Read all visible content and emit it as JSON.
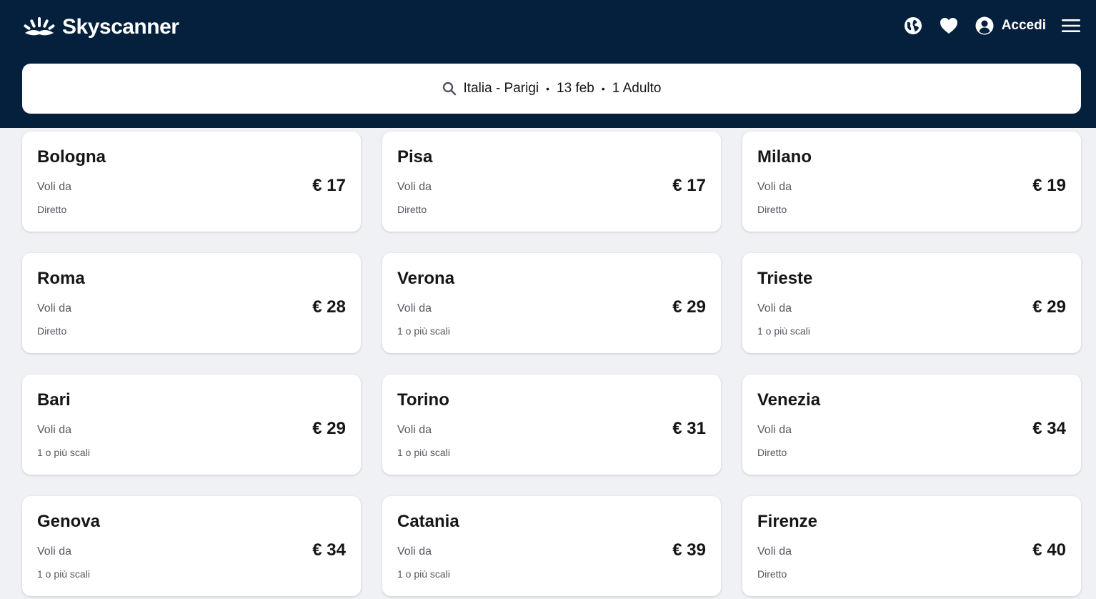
{
  "brand": {
    "name": "Skyscanner"
  },
  "nav": {
    "login_label": "Accedi"
  },
  "search": {
    "route": "Italia - Parigi",
    "date": "13 feb",
    "travellers": "1 Adulto",
    "separator": "•"
  },
  "colors": {
    "header_bg": "#05203c",
    "page_bg": "#eff1f5",
    "card_bg": "#ffffff"
  },
  "results": [
    {
      "city": "Bologna",
      "label": "Voli da",
      "price": "€ 17",
      "stops": "Diretto"
    },
    {
      "city": "Pisa",
      "label": "Voli da",
      "price": "€ 17",
      "stops": "Diretto"
    },
    {
      "city": "Milano",
      "label": "Voli da",
      "price": "€ 19",
      "stops": "Diretto"
    },
    {
      "city": "Roma",
      "label": "Voli da",
      "price": "€ 28",
      "stops": "Diretto"
    },
    {
      "city": "Verona",
      "label": "Voli da",
      "price": "€ 29",
      "stops": "1 o più scali"
    },
    {
      "city": "Trieste",
      "label": "Voli da",
      "price": "€ 29",
      "stops": "1 o più scali"
    },
    {
      "city": "Bari",
      "label": "Voli da",
      "price": "€ 29",
      "stops": "1 o più scali"
    },
    {
      "city": "Torino",
      "label": "Voli da",
      "price": "€ 31",
      "stops": "1 o più scali"
    },
    {
      "city": "Venezia",
      "label": "Voli da",
      "price": "€ 34",
      "stops": "Diretto"
    },
    {
      "city": "Genova",
      "label": "Voli da",
      "price": "€ 34",
      "stops": "1 o più scali"
    },
    {
      "city": "Catania",
      "label": "Voli da",
      "price": "€ 39",
      "stops": "1 o più scali"
    },
    {
      "city": "Firenze",
      "label": "Voli da",
      "price": "€ 40",
      "stops": "Diretto"
    }
  ]
}
